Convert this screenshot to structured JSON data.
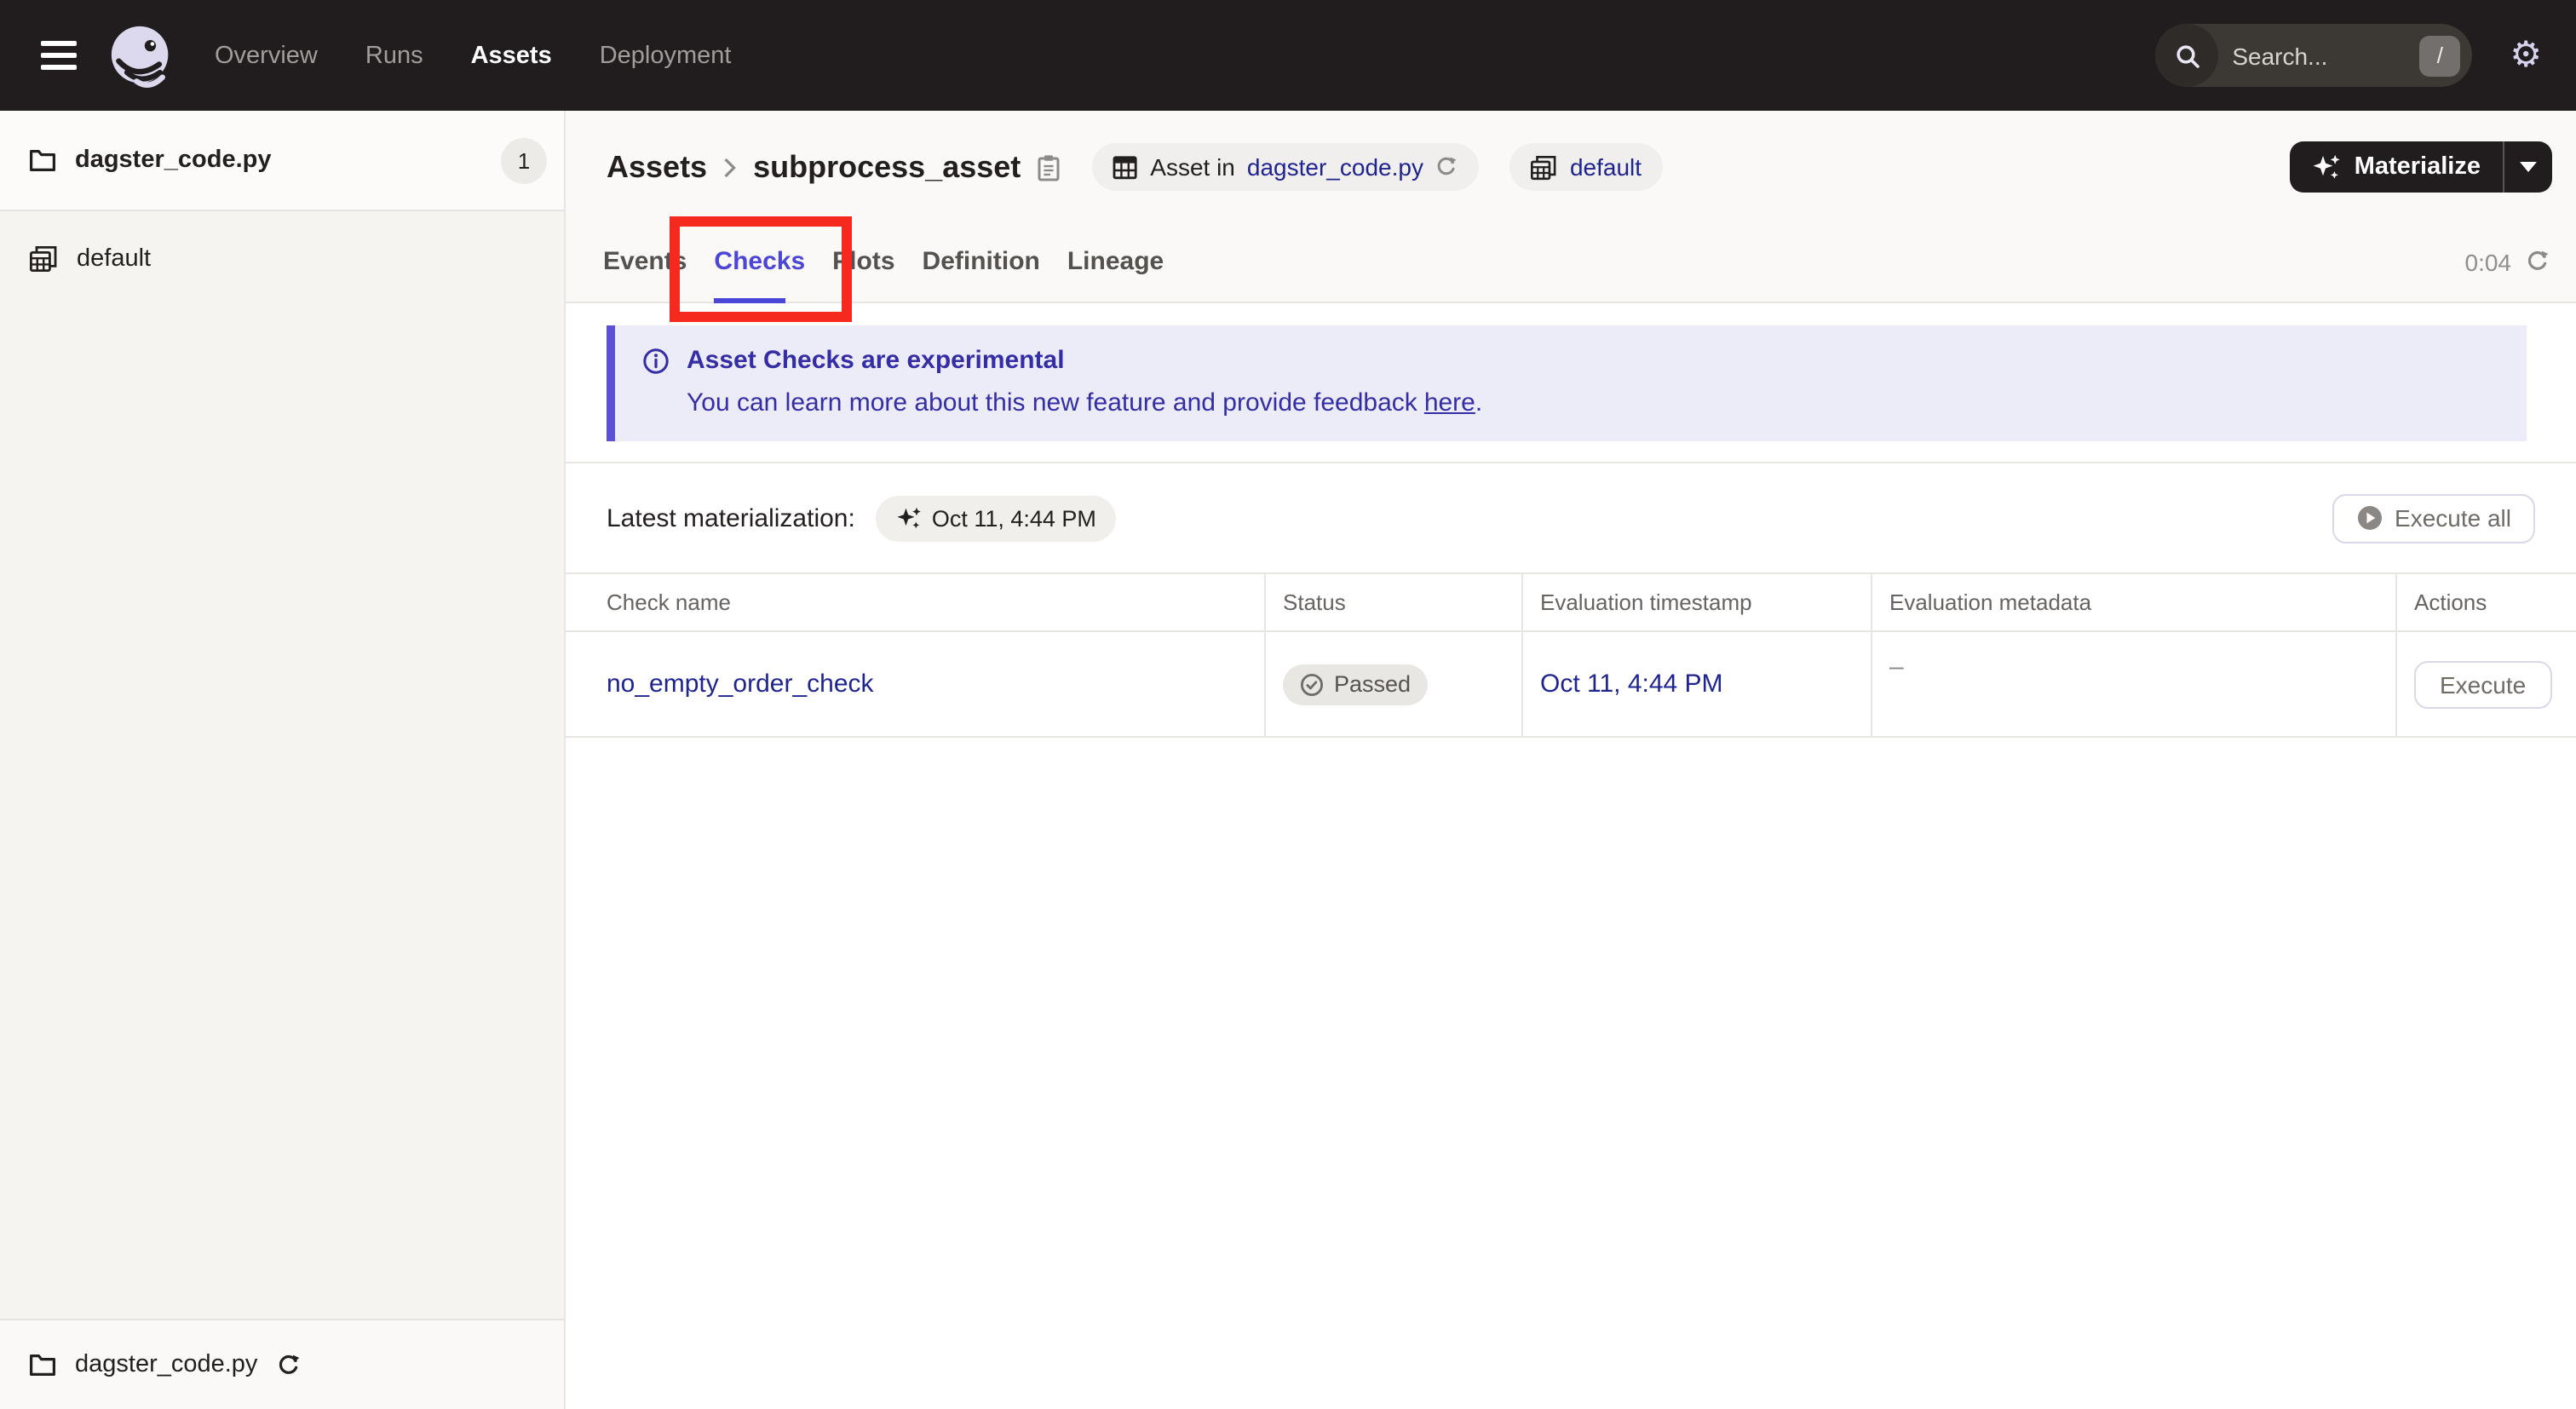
{
  "topnav": {
    "items": [
      {
        "label": "Overview"
      },
      {
        "label": "Runs"
      },
      {
        "label": "Assets"
      },
      {
        "label": "Deployment"
      }
    ],
    "active_item": "Assets",
    "search": {
      "placeholder": "Search...",
      "shortcut": "/"
    }
  },
  "sidebar": {
    "top_item": {
      "label": "dagster_code.py",
      "badge": "1"
    },
    "default_item": {
      "label": "default"
    },
    "bottom_item": {
      "label": "dagster_code.py"
    }
  },
  "header": {
    "breadcrumb": {
      "root": "Assets",
      "current": "subprocess_asset"
    },
    "chip_asset": {
      "prefix": "Asset in",
      "link": "dagster_code.py"
    },
    "chip_group": {
      "link": "default"
    },
    "materialize_label": "Materialize"
  },
  "tabs": {
    "items": [
      {
        "label": "Events"
      },
      {
        "label": "Checks"
      },
      {
        "label": "Plots"
      },
      {
        "label": "Definition"
      },
      {
        "label": "Lineage"
      }
    ],
    "active": "Checks",
    "timer": "0:04"
  },
  "banner": {
    "title": "Asset Checks are experimental",
    "body": "You can learn more about this new feature and provide feedback",
    "link_text": "here",
    "period": "."
  },
  "toolbar": {
    "latest_label": "Latest materialization:",
    "latest_value": "Oct 11, 4:44 PM",
    "execute_all": "Execute all"
  },
  "table": {
    "columns": [
      {
        "label": "Check name"
      },
      {
        "label": "Status"
      },
      {
        "label": "Evaluation timestamp"
      },
      {
        "label": "Evaluation metadata"
      },
      {
        "label": "Actions"
      }
    ],
    "rows": [
      {
        "check_name": "no_empty_order_check",
        "status": "Passed",
        "timestamp": "Oct 11, 4:44 PM",
        "metadata": "–",
        "action": "Execute"
      }
    ]
  },
  "colors": {
    "accent_purple": "#4c46d6",
    "annotation_red": "#f5291d",
    "link_navy": "#1e2490",
    "banner_indigo": "#342da6",
    "topnav_bg": "#211d1e"
  }
}
